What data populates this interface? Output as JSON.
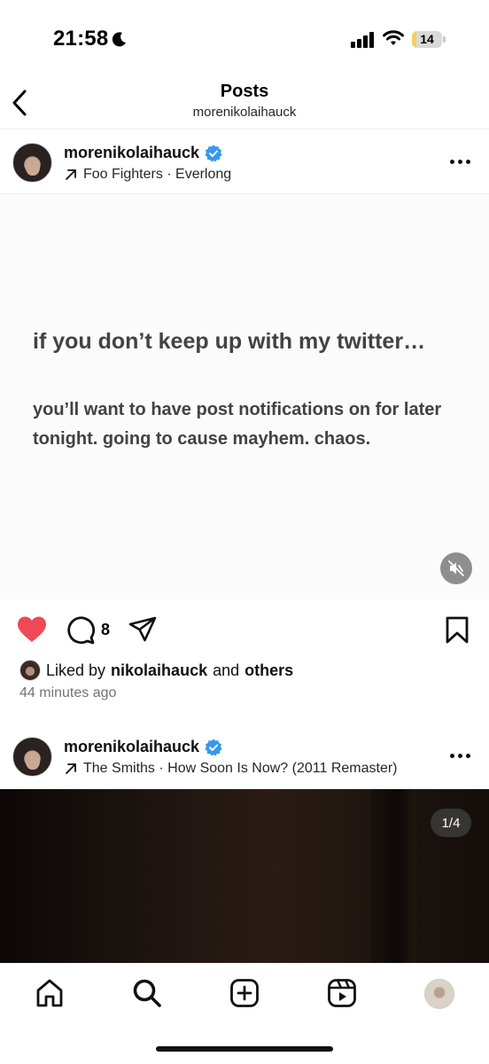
{
  "status_bar": {
    "time": "21:58",
    "battery_level": "14",
    "battery_fraction": 0.14,
    "icons": [
      "moon-icon",
      "cellular-signal-icon",
      "wifi-icon",
      "battery-icon"
    ]
  },
  "header": {
    "title": "Posts",
    "subtitle": "morenikolaihauck"
  },
  "post1": {
    "username": "morenikolaihauck",
    "music": "Foo Fighters · Everlong",
    "headline": "if you don’t keep up with my twitter…",
    "body": "you’ll want to have post notifications on for later tonight. going to cause mayhem. chaos.",
    "comment_count": "8",
    "liked_prefix": "Liked by",
    "liked_user": "nikolaihauck",
    "liked_and": "and",
    "liked_others": "others",
    "timestamp": "44 minutes ago",
    "liked": true
  },
  "post2": {
    "username": "morenikolaihauck",
    "music": "The Smiths · How Soon Is Now? (2011 Remaster)",
    "page_indicator": "1/4"
  },
  "tabbar": {
    "tabs": [
      "home-icon",
      "search-icon",
      "create-icon",
      "reels-icon",
      "profile-avatar"
    ]
  },
  "colors": {
    "like": "#ed4956",
    "verified": "#3897f0",
    "battery": "#f4d15c"
  }
}
